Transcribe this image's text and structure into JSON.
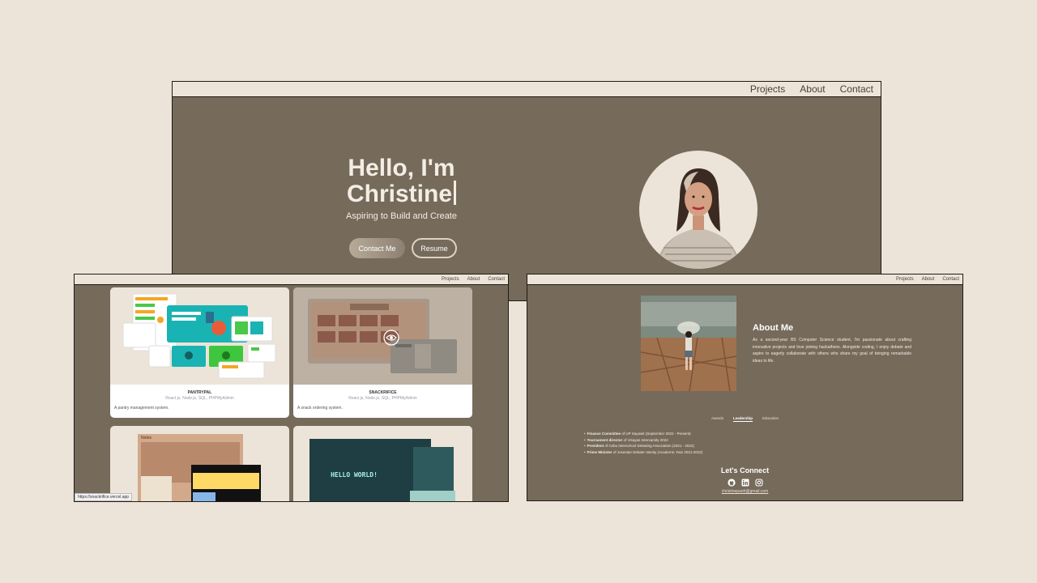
{
  "hero_page": {
    "nav": [
      "Projects",
      "About",
      "Contact"
    ],
    "greeting_line1": "Hello, I'm",
    "greeting_line2": "Christine",
    "subtitle": "Aspiring to Build and Create",
    "contact_button": "Contact Me",
    "resume_button": "Resume"
  },
  "projects_page": {
    "nav": [
      "Projects",
      "About",
      "Contact"
    ],
    "cards": [
      {
        "title": "PANTRYPAL",
        "tech": "React.js, Node.js, SQL, PHPMyAdmin",
        "description": "A pantry management system."
      },
      {
        "title": "SNACKRIFICE",
        "tech": "React.js, Node.js, SQL, PHPMyAdmin",
        "description": "A snack ordering system."
      },
      {
        "label": "Notes"
      },
      {
        "label": "HELLO WORLD!"
      }
    ],
    "status_url": "https://snackrifice.vercel.app"
  },
  "about_page": {
    "nav": [
      "Projects",
      "About",
      "Contact"
    ],
    "title": "About Me",
    "text": "As a second-year BS Computer Science student, I'm passionate about crafting innovative projects and love joining hackathons. Alongside coding, I enjoy debate and aspire to eagerly collaborate with others who share my goal of bringing remarkable ideas to life.",
    "tabs": [
      "Awards",
      "Leadership",
      "Education"
    ],
    "active_tab": "Leadership",
    "leadership": [
      {
        "role": "Finance Committee",
        "detail": "of UP Sayawit (September 2022 - Present)"
      },
      {
        "role": "Tournament director",
        "detail": "of Visayas Intervarsity 2022"
      },
      {
        "role": "President",
        "detail": "of Cebu Interschool Debating Association (2021 - 2022)"
      },
      {
        "role": "Prime Minister",
        "detail": "of Josenian Debate Varsity (Academic Year 2021-2022)"
      }
    ],
    "connect_title": "Let's Connect",
    "social_icons": [
      "github-icon",
      "linkedin-icon",
      "instagram-icon"
    ],
    "email": "christinepaoh@gmail.com"
  },
  "colors": {
    "background": "#ece4d8",
    "frame": "#766a5b",
    "text_light": "#f3ede4"
  }
}
